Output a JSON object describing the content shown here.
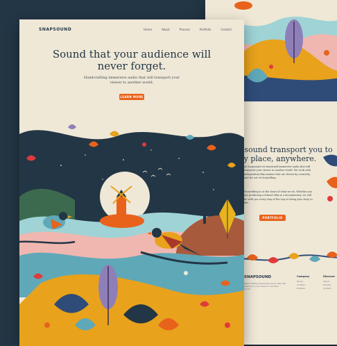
{
  "front": {
    "brand": "SNAPSOUND",
    "nav": [
      "Home",
      "About",
      "Process",
      "Portfolio",
      "Contact"
    ],
    "hero_title": "Sound that your audience will never forget.",
    "hero_subtitle": "Handcrafting immersive audio that will transport your viewer to another world.",
    "cta": "LEARN MORE"
  },
  "back": {
    "title": "et sound transport you to any place, anywhere.",
    "para1": "At Snapsound we handcraft immersive audio that will transport your viewer to another world. We work with independent film makers that are driven by creativity and the art of storytelling.",
    "para2": "Storytelling is at the heart of what we do. Whether you are producing a feature film or a documentary, we will be with you every step of the way to bring your story to life.",
    "cta": "PORTFOLIO",
    "footer_brand": "SNAPSOUND",
    "footer_tagline": "Handcrafting immersive audio that will transport your viewer to another world.",
    "footer_columns": [
      {
        "heading": "Company",
        "items": [
          "Home",
          "Contact",
          "Portfolio"
        ]
      },
      {
        "heading": "Discover",
        "items": [
          "About",
          "Process",
          "Contact"
        ]
      }
    ]
  }
}
